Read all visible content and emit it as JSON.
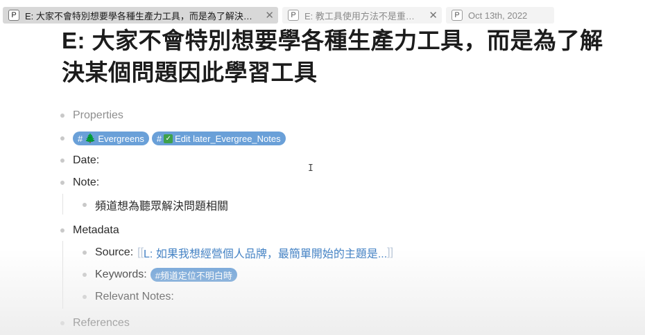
{
  "tabs": [
    {
      "icon": "P",
      "title": "E: 大家不會特別想要學各種生產力工具，而是為了解決某個問...",
      "active": true
    },
    {
      "icon": "P",
      "title": "E: 教工具使用方法不是重點...",
      "active": false
    },
    {
      "icon": "P",
      "title": "Oct 13th, 2022",
      "active": false
    }
  ],
  "page": {
    "title_line1": "E: 大家不會特別想要學各種生產力工具，而是為了解",
    "title_line2": "決某個問題因此學習工具"
  },
  "blocks": {
    "properties": "Properties",
    "tags": [
      {
        "hash": "#",
        "label": "Evergreens"
      },
      {
        "hash": "#",
        "label": "Edit later_Evergree_Notes"
      }
    ],
    "date_label": "Date:",
    "note_label": "Note:",
    "note_child": "頻道想為聽眾解決問題相關",
    "metadata_label": "Metadata",
    "source_label": "Source:",
    "source_link_open": "[[",
    "source_link_text": "L: 如果我想經營個人品牌，最簡單開始的主題是...",
    "source_link_close": "]]",
    "keywords_label": "Keywords:",
    "keyword_tag": "#頻道定位不明白時",
    "relevant_label": "Relevant Notes:",
    "references_label": "References"
  },
  "cursor_glyph": "I"
}
